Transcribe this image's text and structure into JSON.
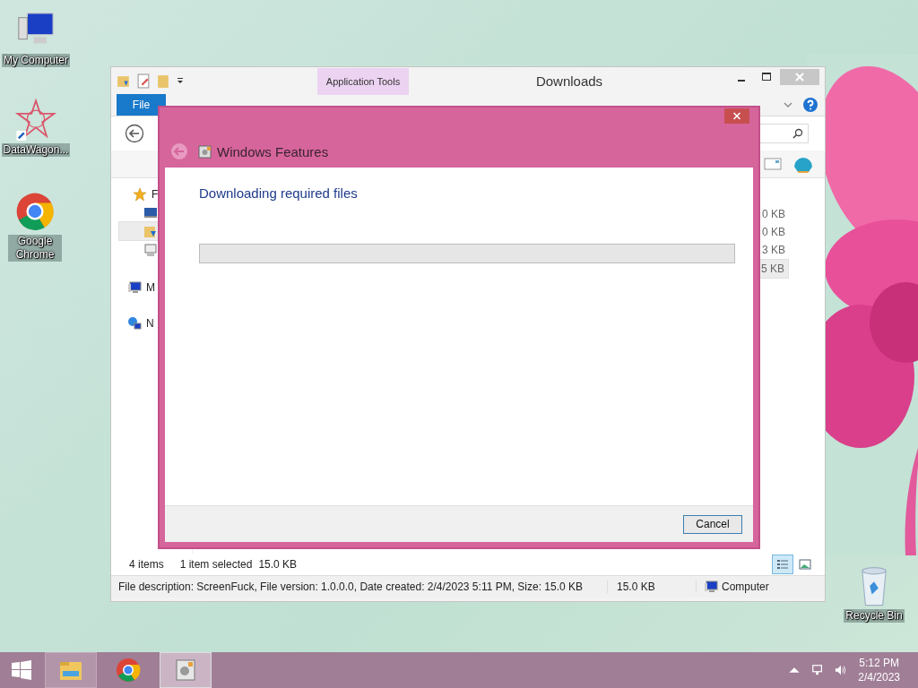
{
  "desktop_icons": [
    {
      "label": "My Computer",
      "kind": "computer"
    },
    {
      "label": "DataWagon...",
      "kind": "star"
    },
    {
      "label": "Google Chrome",
      "kind": "chrome"
    },
    {
      "label": "Recycle Bin",
      "kind": "bin"
    }
  ],
  "explorer": {
    "title": "Downloads",
    "contextual_tab": "Application Tools",
    "file_tab": "File",
    "nav_items": [
      {
        "label": "F",
        "kind": "favorites",
        "selected": false
      },
      {
        "kind": "desktop",
        "selected": false
      },
      {
        "kind": "downloads",
        "selected": true
      },
      {
        "kind": "places",
        "selected": false
      },
      {
        "label": "M",
        "kind": "computer",
        "selected": false
      },
      {
        "label": "N",
        "kind": "network",
        "selected": false
      }
    ],
    "sizes": [
      {
        "text": "0 KB",
        "selected": false
      },
      {
        "text": "0 KB",
        "selected": false
      },
      {
        "text": "3 KB",
        "selected": false
      },
      {
        "text": "5 KB",
        "selected": true
      }
    ],
    "item_count": "4 items",
    "selection": "1 item selected",
    "selection_size": "15.0 KB",
    "views": [
      {
        "kind": "details",
        "selected": true
      },
      {
        "kind": "large_icons",
        "selected": false
      }
    ],
    "details_bar": {
      "description": "File description: ScreenFuck, File version: 1.0.0.0, Date created: 2/4/2023 5:11 PM, Size: 15.0 KB",
      "size": "15.0 KB",
      "location": "Computer"
    }
  },
  "dialog": {
    "title": "Windows Features",
    "heading": "Downloading required files",
    "progress": {
      "level": 0
    },
    "buttons": [
      "Cancel"
    ]
  },
  "taskbar": {
    "apps": [
      {
        "kind": "explorer",
        "running": true,
        "active": false
      },
      {
        "kind": "chrome",
        "running": false,
        "active": false
      },
      {
        "kind": "features",
        "running": true,
        "active": true
      }
    ],
    "time": "5:12 PM",
    "date": "2/4/2023"
  }
}
